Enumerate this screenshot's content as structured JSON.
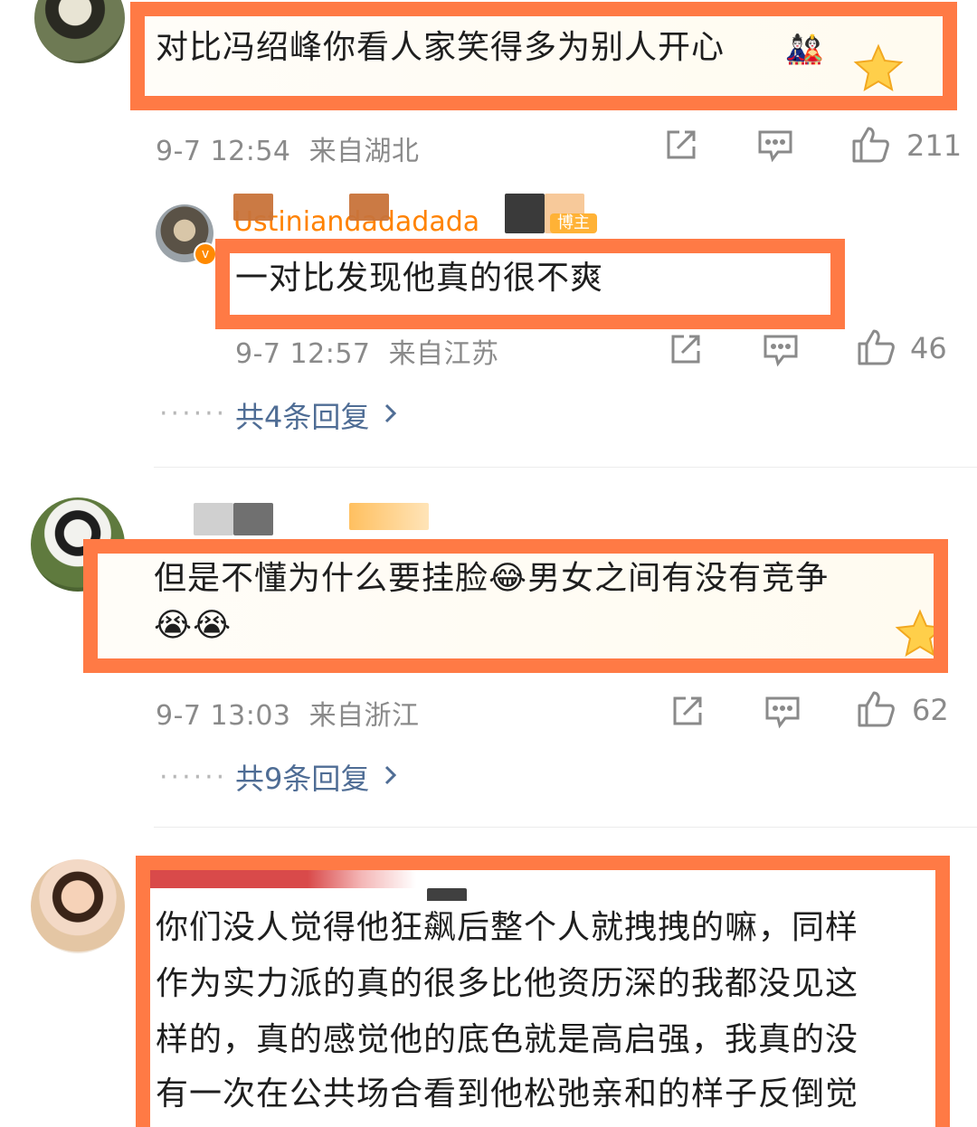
{
  "accent_color": "#ff7a45",
  "comments": [
    {
      "text": "对比冯绍峰你看人家笑得多为别人开心",
      "meta": "9-7 12:54  来自湖北",
      "likes": "211",
      "reply": {
        "username": "Ustiniandadadada",
        "badge": "博主",
        "text": "一对比发现他真的很不爽",
        "meta": "9-7 12:57  来自江苏",
        "likes": "46"
      },
      "replies_label": "共4条回复"
    },
    {
      "text_line1": "但是不懂为什么要挂脸😂男女之间有没有竞争",
      "text_line2": "😭😭",
      "meta": "9-7 13:03  来自浙江",
      "likes": "62",
      "replies_label": "共9条回复"
    },
    {
      "lines": [
        "你们没人觉得他狂飙后整个人就拽拽的嘛，同样",
        "作为实力派的真的很多比他资历深的我都没见这",
        "样的，真的感觉他的底色就是高启强，我真的没",
        "有一次在公共场合看到他松弛亲和的样子反倒觉"
      ]
    }
  ],
  "icons": [
    "share-icon",
    "comment-icon",
    "like-icon",
    "chevron-right-icon"
  ]
}
